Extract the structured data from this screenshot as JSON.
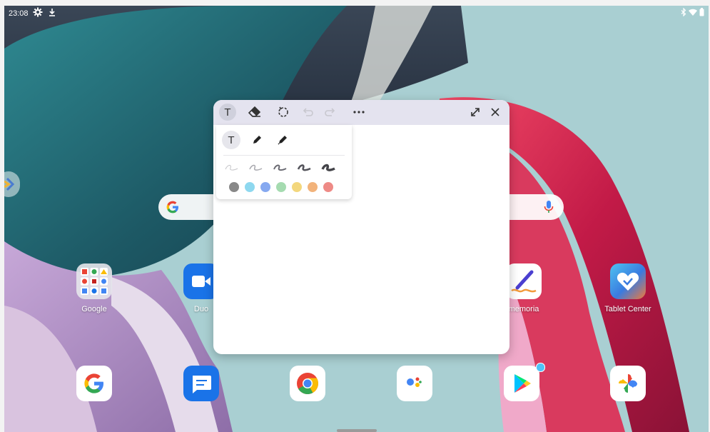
{
  "status_bar": {
    "time": "23:08",
    "icons": [
      "gear-icon",
      "download-icon",
      "bluetooth-icon",
      "wifi-icon",
      "battery-icon"
    ]
  },
  "search": {
    "logo": "google-g-icon",
    "mic": "mic-icon"
  },
  "apps": [
    {
      "name": "google-folder",
      "label": "Google"
    },
    {
      "name": "duo",
      "label": "Duo"
    },
    {
      "name": "nebo-memoria",
      "label": "memoria"
    },
    {
      "name": "tablet-center",
      "label": "Tablet Center"
    }
  ],
  "dock": [
    "google-icon",
    "messages-icon",
    "chrome-icon",
    "assistant-icon",
    "play-store-icon",
    "photos-icon"
  ],
  "note_window": {
    "toolbar": {
      "text_tool": "T",
      "icons": [
        "eraser-icon",
        "lasso-icon",
        "undo-icon",
        "redo-icon",
        "more-icon",
        "expand-icon",
        "close-icon"
      ]
    },
    "pen_popup": {
      "text_tool": "T",
      "colors": [
        "#888888",
        "#8ed8ef",
        "#86a9f0",
        "#a5dbb0",
        "#f3d77d",
        "#f2b37b",
        "#ee8a86"
      ]
    }
  },
  "colors": {
    "toolbar_bg": "#e4e3ef",
    "accent_blue": "#1a73e8"
  }
}
